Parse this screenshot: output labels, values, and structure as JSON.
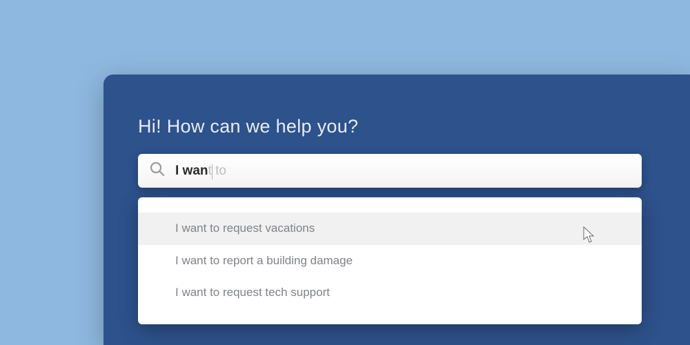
{
  "heading": "Hi! How can we help you?",
  "search": {
    "typed": "I wan",
    "suffix": "t to"
  },
  "suggestions": [
    "I want to request vacations",
    "I want to report a building damage",
    "I want to request tech support"
  ]
}
